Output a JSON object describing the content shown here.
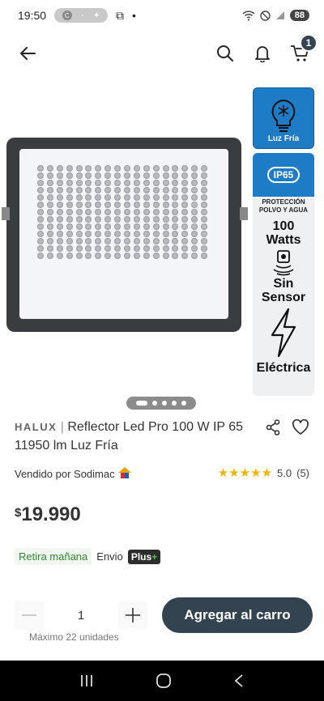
{
  "status": {
    "time": "19:50",
    "pill_letter": "C",
    "battery": "88"
  },
  "header": {
    "back": "back",
    "search": "search",
    "notifications": "bell",
    "cart_count": "1"
  },
  "gallery": {
    "spec_top_label": "Luz Fría",
    "ip_rating": "IP65",
    "protection": "PROTECCIÓN POLVO Y AGUA",
    "watts_value": "100",
    "watts_unit": "Watts",
    "sensor_line1": "Sin",
    "sensor_line2": "Sensor",
    "type": "Eléctrica",
    "image_count": 5,
    "active_image": 1
  },
  "product": {
    "brand": "HALUX",
    "separator": "|",
    "name": "Reflector Led Pro 100 W IP 65 11950 lm Luz Fría",
    "seller_prefix": "Vendido por",
    "seller": "Sodimac",
    "rating_value": "5.0",
    "rating_count": "(5)",
    "stars": 5,
    "price_currency": "$",
    "price_amount": "19.990"
  },
  "delivery": {
    "pickup": "Retira mañana",
    "envio": "Envio",
    "plus_label": "Plus",
    "plus_sign": "+"
  },
  "purchase": {
    "quantity": "1",
    "add_label": "Agregar al carro",
    "max_label": "Máximo 22 unidades"
  },
  "colors": {
    "primary": "#33434f",
    "accent_blue": "#1e7bc5",
    "star": "#f2b400",
    "green": "#2f8a2f"
  }
}
